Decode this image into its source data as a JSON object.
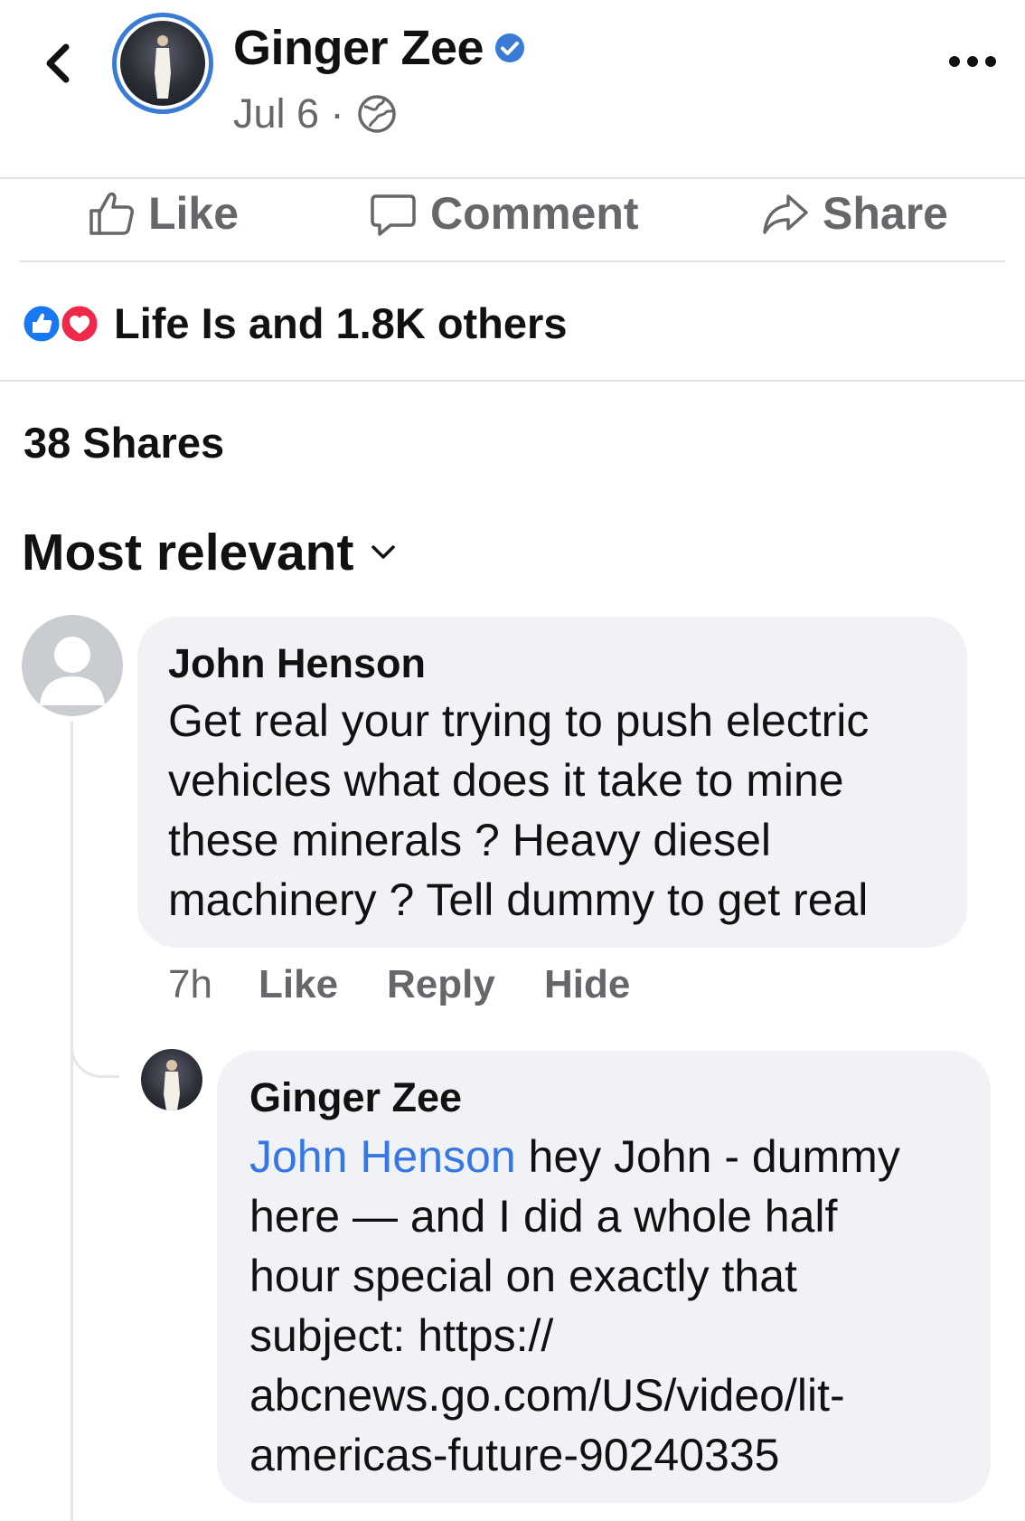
{
  "post": {
    "author": "Ginger Zee",
    "date": "Jul 6 ·"
  },
  "actions": {
    "like": "Like",
    "comment": "Comment",
    "share": "Share"
  },
  "reactions": {
    "summary": "Life Is and 1.8K others"
  },
  "shares": "38 Shares",
  "sort": {
    "label": "Most relevant"
  },
  "comments": [
    {
      "author": "John Henson",
      "lines": [
        "Get real your trying to push electric",
        "vehicles what does it take to mine",
        "these minerals ? Heavy diesel",
        "machinery ? Tell dummy to get real"
      ],
      "time": "7h",
      "like": "Like",
      "reply": "Reply",
      "hide": "Hide"
    },
    {
      "author": "Ginger Zee",
      "mention": "John Henson",
      "line1_rest": " hey John - dummy",
      "lines": [
        "here — and I did a whole half",
        "hour special on exactly that",
        "subject:  https://",
        "abcnews.go.com/US/video/lit-",
        "americas-future-90240335"
      ]
    }
  ],
  "icons": {
    "back": "chevron-left-icon",
    "verified": "verified-badge-icon",
    "privacy": "globe-icon",
    "more": "more-dots-icon",
    "like": "thumbs-up-icon",
    "comment": "speech-bubble-icon",
    "share": "share-arrow-icon",
    "sort": "chevron-down-icon"
  },
  "colors": {
    "brand_blue": "#3a7bd5",
    "mention_blue": "#3578e5",
    "muted_text": "#65676b",
    "bubble_bg": "#f0f2f5",
    "heart_red": "#f0284a"
  }
}
